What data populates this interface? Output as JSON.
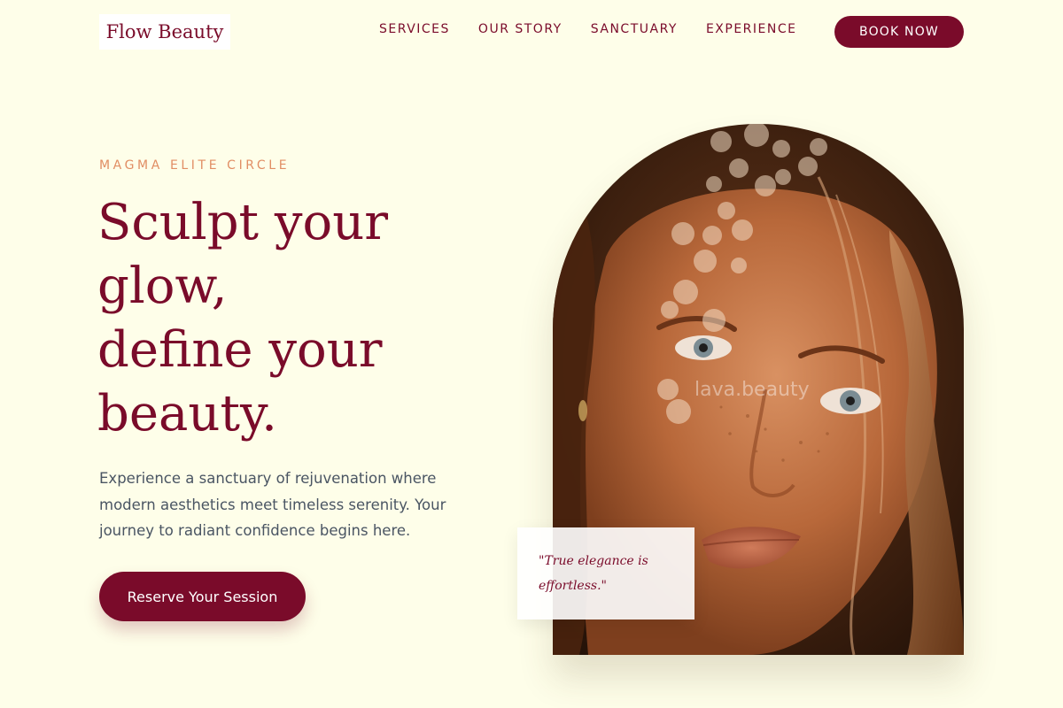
{
  "header": {
    "logo_text": "Flow Beauty",
    "nav": [
      {
        "label": "SERVICES"
      },
      {
        "label": "OUR STORY"
      },
      {
        "label": "SANCTUARY"
      },
      {
        "label": "EXPERIENCE"
      }
    ],
    "book_label": "BOOK NOW"
  },
  "hero": {
    "eyebrow": "MAGMA ELITE CIRCLE",
    "headline_lines": [
      "Sculpt your",
      "glow,",
      "define your",
      "beauty."
    ],
    "intro": "Experience a sanctuary of rejuvenation where modern aesthetics meet timeless serenity. Your journey to radiant confidence begins here.",
    "cta_label": "Reserve Your Session",
    "image_watermark": "lava.beauty",
    "quote": "\"True elegance is effortless.\""
  },
  "colors": {
    "background": "#fefee9",
    "brand": "#7a0b2a",
    "accent": "#e18e64",
    "body_text": "#4a5563"
  }
}
